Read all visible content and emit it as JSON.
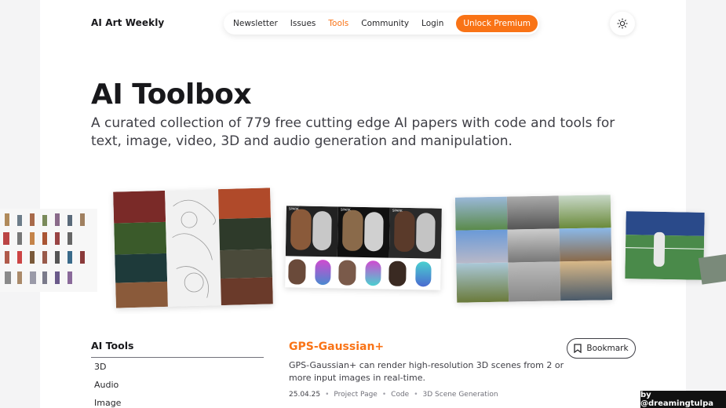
{
  "header": {
    "brand": "AI Art Weekly",
    "nav": [
      "Newsletter",
      "Issues",
      "Tools",
      "Community",
      "Login"
    ],
    "active_nav": "Tools",
    "premium_label": "Unlock Premium",
    "theme_icon": "sun-icon"
  },
  "hero": {
    "title": "AI Toolbox",
    "subtitle": "A curated collection of 779 free cutting edge AI papers with code and tools for text, image, video, 3D and audio generation and manipulation."
  },
  "gallery": {
    "images": [
      "character-sprites-image",
      "anime-frames-image",
      "face-3d-reconstruction-image",
      "landscape-grid-image",
      "tennis-scene-image"
    ],
    "spark_labels": [
      "SPARK",
      "SPARK",
      "SPARK"
    ]
  },
  "sidebar": {
    "title": "AI Tools",
    "items": [
      "3D",
      "Audio",
      "Image"
    ]
  },
  "tool": {
    "title": "GPS-Gaussian+",
    "description": "GPS-Gaussian+ can render high-resolution 3D scenes from 2 or more input images in real-time.",
    "date": "25.04.25",
    "links": [
      "Project Page",
      "Code",
      "3D Scene Generation"
    ],
    "bookmark_label": "Bookmark"
  },
  "credit": "by @dreamingtulpa",
  "colors": {
    "accent": "#f97316",
    "text": "#27272a",
    "page_bg": "#ffffff",
    "outer_bg": "#f4f4f5"
  }
}
